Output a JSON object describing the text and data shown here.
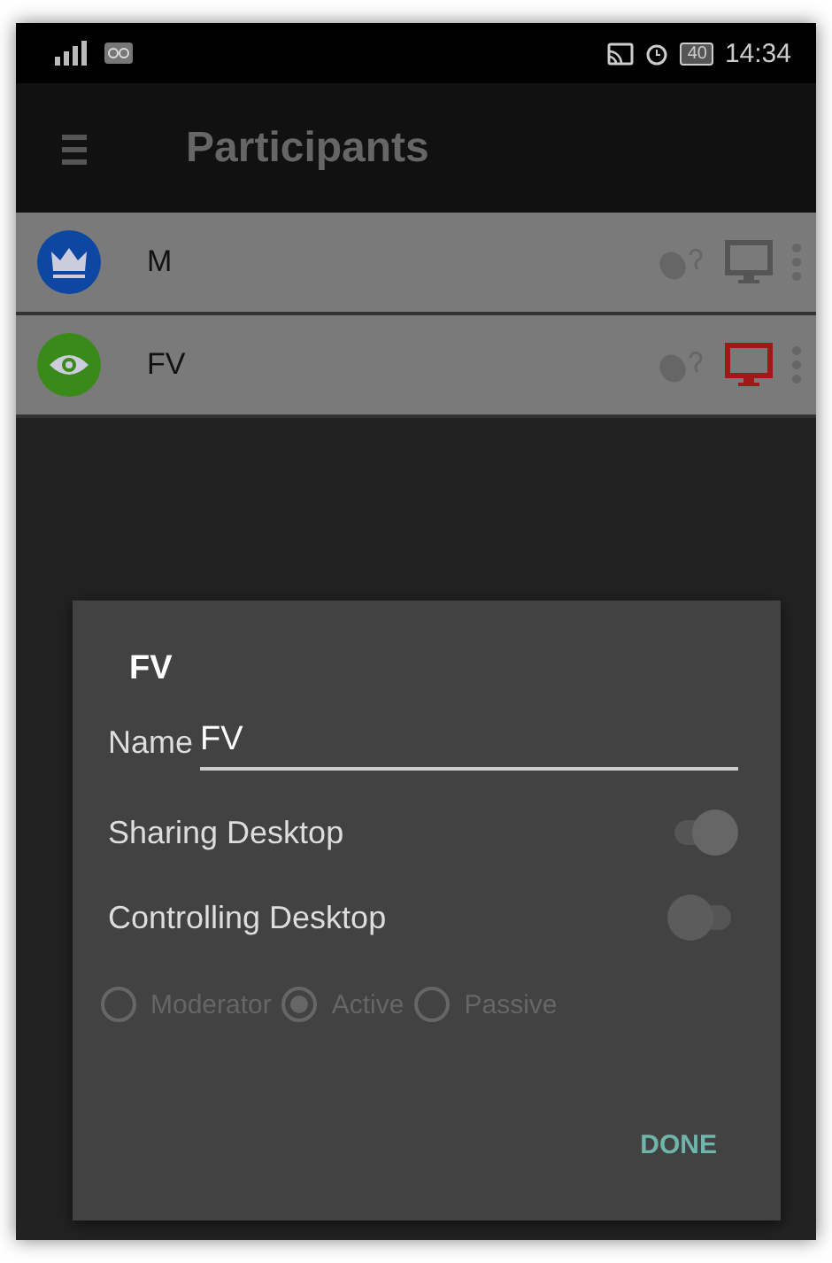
{
  "status_bar": {
    "battery": "40",
    "time": "14:34"
  },
  "toolbar": {
    "title": "Participants"
  },
  "participants": [
    {
      "name": "M",
      "kind": "moderator",
      "color": "#0d47a1",
      "sharing": false
    },
    {
      "name": "FV",
      "kind": "viewer",
      "color": "#3a8a1a",
      "sharing": true
    }
  ],
  "dialog": {
    "title": "FV",
    "name_label": "Name",
    "name_value": "FV",
    "toggles": [
      {
        "label": "Sharing Desktop",
        "on": true
      },
      {
        "label": "Controlling Desktop",
        "on": false
      }
    ],
    "roles_disabled": true,
    "roles": [
      {
        "label": "Moderator",
        "selected": false
      },
      {
        "label": "Active",
        "selected": true
      },
      {
        "label": "Passive",
        "selected": false
      }
    ],
    "button": "DONE"
  }
}
